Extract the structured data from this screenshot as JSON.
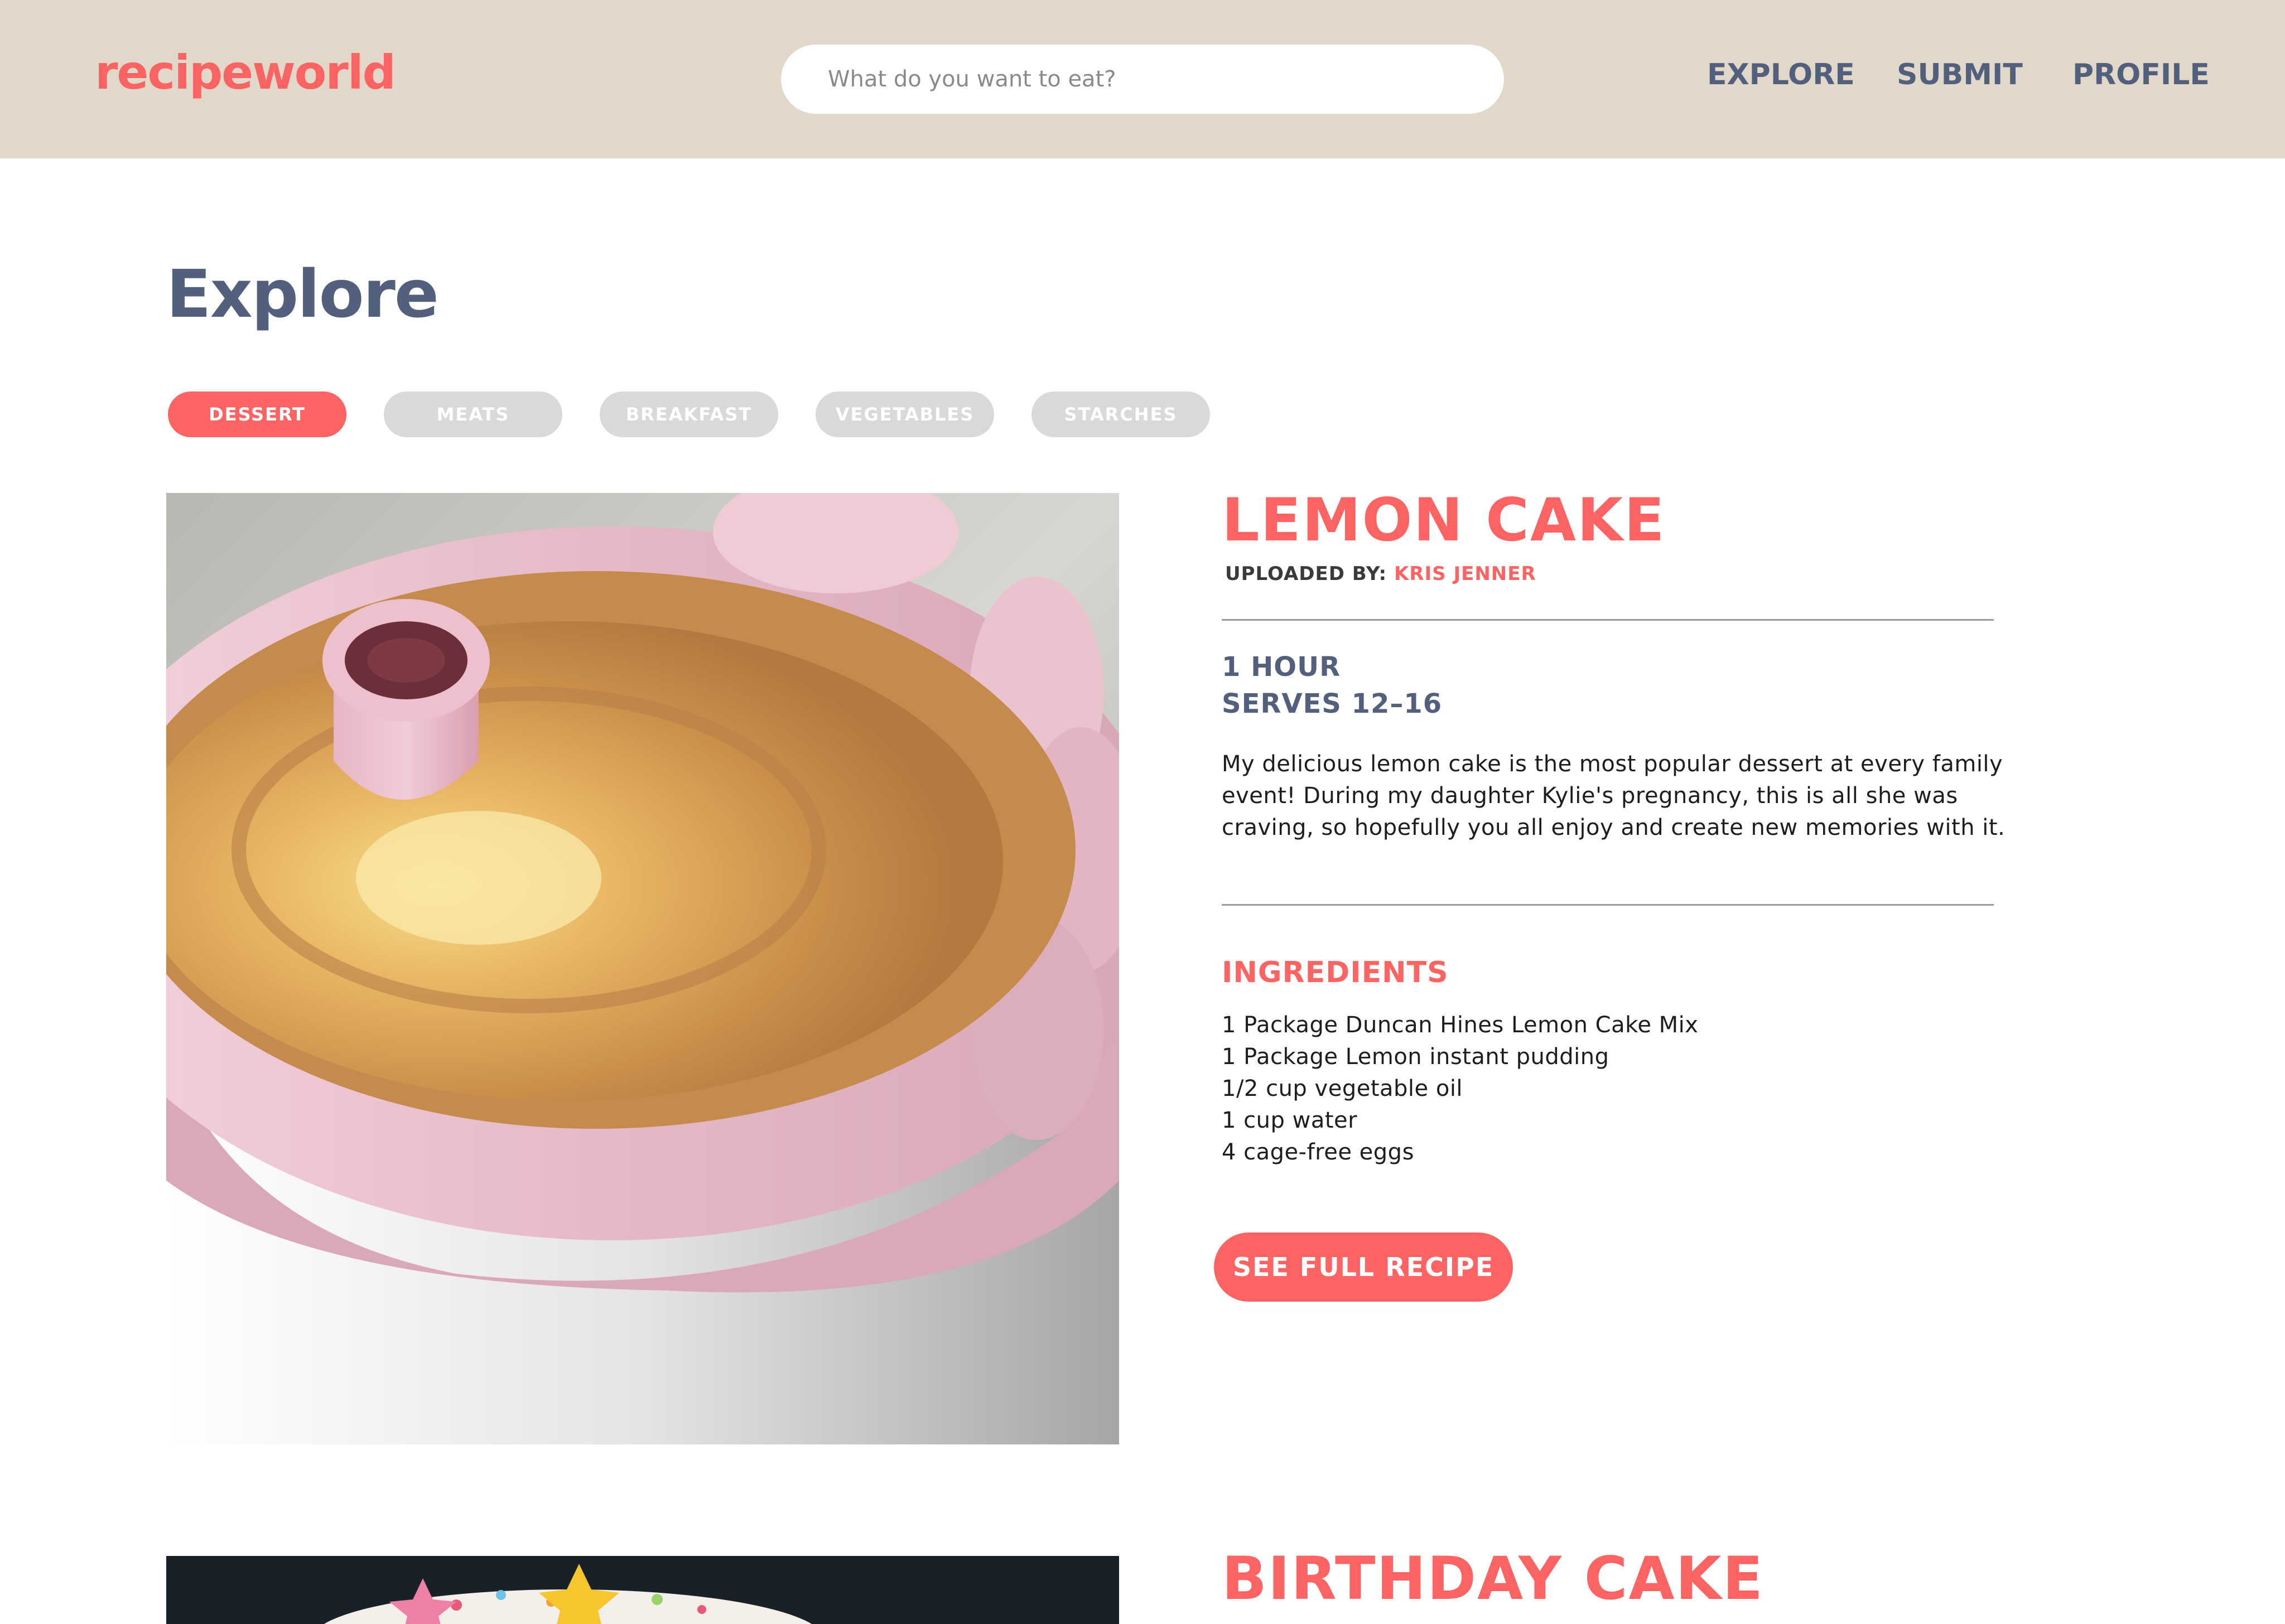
{
  "header": {
    "logo": "recipeworld",
    "search_placeholder": "What do you want to eat?",
    "nav": [
      "EXPLORE",
      "SUBMIT",
      "PROFILE"
    ]
  },
  "page": {
    "title": "Explore",
    "filters": [
      "DESSERT",
      "MEATS",
      "BREAKFAST",
      "VEGETABLES",
      "STARCHES"
    ],
    "active_filter": "DESSERT"
  },
  "recipes": [
    {
      "title": "LEMON CAKE",
      "uploaded_by_label": "UPLOADED BY:",
      "uploader": "KRIS JENNER",
      "time": "1 HOUR",
      "serves": "SERVES 12–16",
      "description": "My delicious lemon cake is the most popular dessert at every family event! During my daughter Kylie's pregnancy, this is all she was craving, so hopefully you all enjoy and create new memories with it.",
      "ingredients_heading": "INGREDIENTS",
      "ingredients": [
        "1 Package Duncan Hines Lemon Cake Mix",
        "1 Package Lemon instant pudding",
        "1/2 cup vegetable oil",
        "1 cup water",
        "4 cage-free eggs"
      ],
      "cta": "SEE FULL RECIPE"
    },
    {
      "title": "BIRTHDAY CAKE"
    }
  ],
  "colors": {
    "accent": "#fb6463",
    "header_bg": "#e2d8c9",
    "nav_text": "#52607e",
    "chip_inactive": "#d9d9d9"
  }
}
